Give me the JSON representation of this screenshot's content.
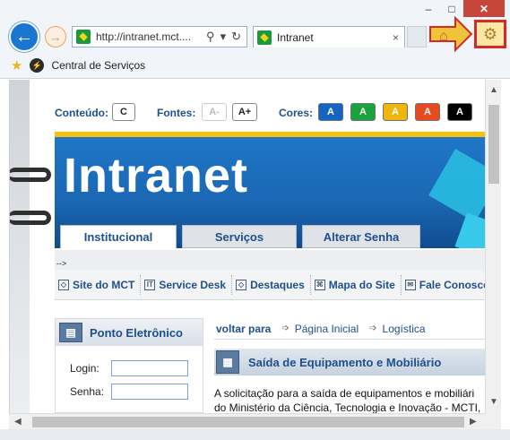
{
  "browser": {
    "address": "http://intranet.mct....",
    "tab_title": "Intranet",
    "tab_close": "×",
    "favorite_link": "Central de Serviços",
    "search_icon": "⚲",
    "refresh_icon": "↻"
  },
  "window": {
    "minimize": "–",
    "maximize": "□",
    "close": "✕"
  },
  "accessibility": {
    "conteudo_label": "Conteúdo:",
    "conteudo_btn": "C",
    "fontes_label": "Fontes:",
    "font_small": "A-",
    "font_large": "A+",
    "cores_label": "Cores:",
    "color_buttons": [
      {
        "label": "A",
        "color": "#1565c0"
      },
      {
        "label": "A",
        "color": "#1aa33a"
      },
      {
        "label": "A",
        "color": "#f2b50c"
      },
      {
        "label": "A",
        "color": "#e8491d"
      },
      {
        "label": "A",
        "color": "#000000"
      }
    ]
  },
  "banner": {
    "title": "Intranet"
  },
  "nav_tabs": [
    "Institucional",
    "Serviços",
    "Alterar Senha"
  ],
  "gap_text": "-->",
  "quick_links": [
    "Site do MCT",
    "Service Desk",
    "Destaques",
    "Mapa do Site",
    "Fale Conosco"
  ],
  "sidebar": {
    "title": "Ponto Eletrônico",
    "login_label": "Login:",
    "senha_label": "Senha:"
  },
  "main": {
    "voltar": "voltar para",
    "links": [
      "Página Inicial",
      "Logística"
    ],
    "section_title": "Saída de Equipamento e Mobiliário",
    "body_lines": [
      "A solicitação para a saída de equipamentos e mobiliári",
      "do Ministério da Ciência, Tecnologia e Inovação - MCTI,"
    ]
  },
  "colors": {
    "accent": "#1e4f8c",
    "banner": "#1b67b3",
    "highlight": "#d42a26"
  }
}
